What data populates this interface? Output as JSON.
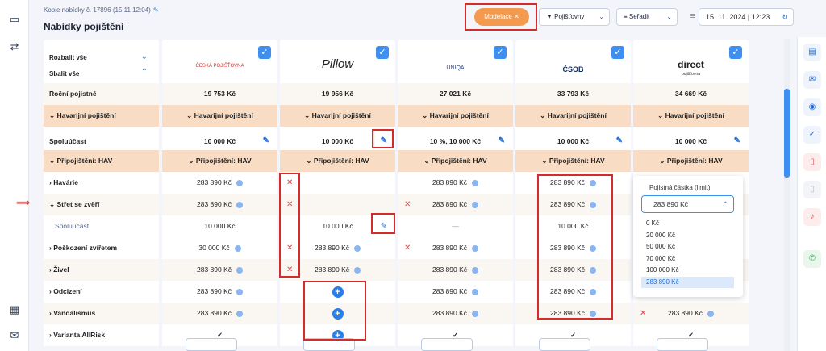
{
  "header": {
    "breadcrumb": "Kopie nabídky č. 17896 (15.11 12:04)",
    "title": "Nabídky pojištění",
    "modelace": "Modelace",
    "modelace_close": "✕",
    "pojistovny": "Pojišťovny",
    "seradit": "Seřadit",
    "date": "15. 11. 2024 | 12:23"
  },
  "sidebar": {
    "rozbalit": "Rozbalit vše",
    "sbalit": "Sbalit vše"
  },
  "insurers": [
    {
      "name": "ČESKÁ POJIŠŤOVNA",
      "premium": "19 753 Kč",
      "spoluucast": "10 000 Kč",
      "havarie": "283 890 Kč",
      "stret": "283 890 Kč",
      "stret_spol": "10 000 Kč",
      "poskozeni": "30 000 Kč",
      "zivel": "283 890 Kč",
      "odcizeni": "283 890 Kč",
      "vandalismus": "283 890 Kč",
      "allrisk": "✓"
    },
    {
      "name": "Pillow",
      "premium": "19 956 Kč",
      "spoluucast": "10 000 Kč",
      "havarie": "✕",
      "stret": "✕",
      "stret_spol": "10 000 Kč",
      "poskozeni": "283 890 Kč",
      "zivel": "283 890 Kč",
      "odcizeni": "+",
      "vandalismus": "+",
      "allrisk": "+"
    },
    {
      "name": "UNIQA",
      "premium": "27 021 Kč",
      "spoluucast": "10 %, 10 000 Kč",
      "havarie": "283 890 Kč",
      "stret": "283 890 Kč",
      "stret_spol": "—",
      "poskozeni": "283 890 Kč",
      "zivel": "283 890 Kč",
      "odcizeni": "283 890 Kč",
      "vandalismus": "283 890 Kč",
      "allrisk": "✓"
    },
    {
      "name": "ČSOB",
      "premium": "33 793 Kč",
      "spoluucast": "10 000 Kč",
      "havarie": "283 890 Kč",
      "stret": "283 890 Kč",
      "stret_spol": "10 000 Kč",
      "poskozeni": "283 890 Kč",
      "zivel": "283 890 Kč",
      "odcizeni": "283 890 Kč",
      "vandalismus": "283 890 Kč",
      "allrisk": "✓"
    },
    {
      "name": "direct",
      "subname": "pojišťovna",
      "premium": "34 669 Kč",
      "spoluucast": "10 000 Kč",
      "vandalismus": "283 890 Kč",
      "allrisk": "✓"
    }
  ],
  "rows": {
    "rocni": "Roční pojistné",
    "havarijni": "Havarijní pojištění",
    "spoluucast": "Spoluúčast",
    "pripojisteni": "Připojištění: HAV",
    "havarie": "Havárie",
    "stret": "Střet se zvěří",
    "stret_spol": "Spoluúčast",
    "poskozeni": "Poškození zvířetem",
    "zivel": "Živel",
    "odcizeni": "Odcizení",
    "vandalismus": "Vandalismus",
    "allrisk": "Varianta AllRisk"
  },
  "dropdown": {
    "title": "Pojistná částka (limit)",
    "value": "283 890 Kč",
    "options": [
      "0 Kč",
      "20 000 Kč",
      "50 000 Kč",
      "70 000 Kč",
      "100 000 Kč",
      "283 890 Kč"
    ]
  }
}
